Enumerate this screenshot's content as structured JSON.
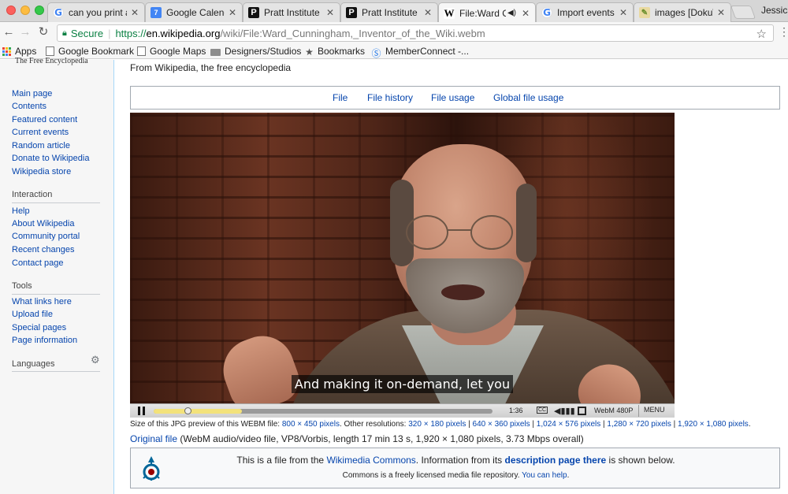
{
  "browser": {
    "tabs": [
      {
        "favicon": "google-icon",
        "title": "can you print a"
      },
      {
        "favicon": "google-calendar-icon",
        "favicon_text": "7",
        "title": "Google Calenda"
      },
      {
        "favicon": "pratt-icon",
        "favicon_text": "P",
        "title": "Pratt Institute"
      },
      {
        "favicon": "pratt-icon",
        "favicon_text": "P",
        "title": "Pratt Institute"
      },
      {
        "favicon": "wikipedia-icon",
        "favicon_text": "W",
        "title": "File:Ward Cu",
        "active": true,
        "audio": true
      },
      {
        "favicon": "google-icon",
        "title": "Import events t"
      },
      {
        "favicon": "dokuwiki-icon",
        "title": "images [DokuW"
      }
    ],
    "profile_name": "Jessica",
    "secure_label": "Secure",
    "url": {
      "scheme": "https://",
      "host": "en.wikipedia.org",
      "path": "/wiki/File:Ward_Cunningham,_Inventor_of_the_Wiki.webm"
    },
    "bookmarks": [
      {
        "icon": "apps-icon",
        "label": "Apps"
      },
      {
        "icon": "page-icon",
        "label": "Google Bookmark"
      },
      {
        "icon": "page-icon",
        "label": "Google Maps"
      },
      {
        "icon": "folder-icon",
        "label": "Designers/Studios"
      },
      {
        "icon": "star-icon",
        "label": "Bookmarks"
      },
      {
        "icon": "memberconnect-icon",
        "label": "MemberConnect -..."
      }
    ]
  },
  "sidebar": {
    "logo_text": "The Free Encyclopedia",
    "nav": [
      "Main page",
      "Contents",
      "Featured content",
      "Current events",
      "Random article",
      "Donate to Wikipedia",
      "Wikipedia store"
    ],
    "interaction_heading": "Interaction",
    "interaction": [
      "Help",
      "About Wikipedia",
      "Community portal",
      "Recent changes",
      "Contact page"
    ],
    "tools_heading": "Tools",
    "tools": [
      "What links here",
      "Upload file",
      "Special pages",
      "Page information"
    ],
    "languages_heading": "Languages"
  },
  "content": {
    "tagline": "From Wikipedia, the free encyclopedia",
    "file_tabs": [
      "File",
      "File history",
      "File usage",
      "Global file usage"
    ],
    "subtitle": "And making it on-demand, let you",
    "player": {
      "time": "1:36",
      "cc": "CC",
      "quality": "WebM 480P",
      "menu": "MENU",
      "progress_fraction": 0.09,
      "buffered_fraction": 0.26
    },
    "size_info": {
      "prefix": "Size of this JPG preview of this WEBM file: ",
      "preview": "800 × 450 pixels",
      "other": ". Other resolutions: ",
      "resolutions": [
        "320 × 180 pixels",
        "640 × 360 pixels",
        "1,024 × 576 pixels",
        "1,280 × 720 pixels",
        "1,920 × 1,080 pixels"
      ],
      "sep": " | ",
      "end": "."
    },
    "original": {
      "link": "Original file",
      "details": " (WebM audio/video file, VP8/Vorbis, length 17 min 13 s, 1,920 × 1,080 pixels, 3.73 Mbps overall)"
    },
    "commons": {
      "t1": "This is a file from the ",
      "link1": "Wikimedia Commons",
      "t2": ". Information from its ",
      "link2": "description page there",
      "t3": " is shown below.",
      "line2": "Commons is a freely licensed media file repository. ",
      "help": "You can help",
      "end": "."
    }
  }
}
